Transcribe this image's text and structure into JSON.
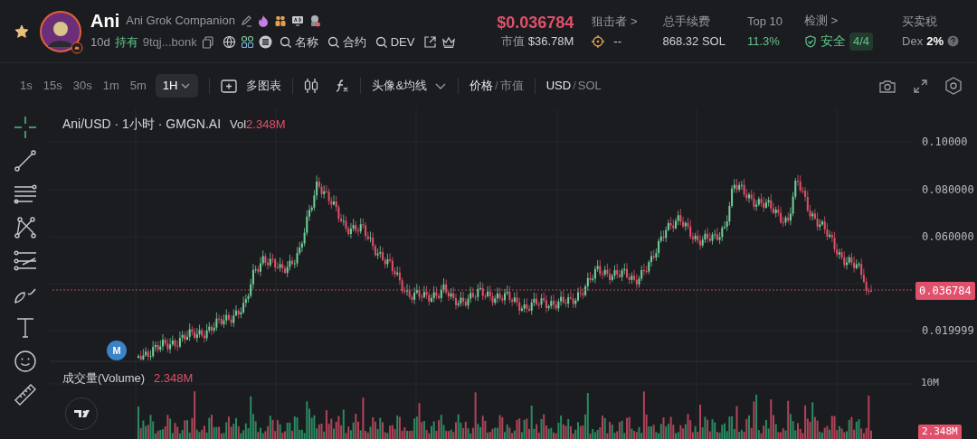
{
  "header": {
    "favorite": true,
    "name": "Ani",
    "full_name": "Ani Grok Companion",
    "age": "10d",
    "holders_label": "持有",
    "address": "9tqj...bonk",
    "searches": [
      "名称",
      "合约",
      "DEV"
    ]
  },
  "stats": {
    "price": "$0.036784",
    "market_cap_label": "市值",
    "market_cap": "$36.78M",
    "items": [
      {
        "kind": "sniper",
        "label": "狙击者 >",
        "value": "--"
      },
      {
        "kind": "plain",
        "label": "总手续费",
        "value": "868.32 SOL"
      },
      {
        "kind": "positive",
        "label": "Top 10",
        "value": "11.3%"
      },
      {
        "kind": "check",
        "label": "检测 >",
        "value": "安全",
        "badge": "4/4"
      },
      {
        "kind": "tax",
        "label": "买卖税",
        "prefix": "Dex",
        "value": "2%"
      }
    ]
  },
  "toolbar": {
    "intervals": [
      {
        "label": "1s",
        "selected": false
      },
      {
        "label": "15s",
        "selected": false
      },
      {
        "label": "30s",
        "selected": false
      },
      {
        "label": "1m",
        "selected": false
      },
      {
        "label": "5m",
        "selected": false
      },
      {
        "label": "1H",
        "selected": true
      }
    ],
    "multi_chart": "多图表",
    "indicators": "头像&均线",
    "price_toggle": [
      {
        "label": "价格",
        "selected": true
      },
      {
        "label": "市值",
        "selected": false
      }
    ],
    "price_separator": "/",
    "currency_toggle": [
      {
        "label": "USD",
        "selected": true
      },
      {
        "label": "SOL",
        "selected": false
      }
    ],
    "currency_separator": "/"
  },
  "chart": {
    "title": "Ani/USD · 1小时 · GMGN.AI",
    "vol_label": "Vol",
    "vol_value": "2.348M",
    "y_labels": [
      "0.10000",
      "0.080000",
      "0.060000",
      "0.019999"
    ],
    "price_tag": "0.036784",
    "marker": "M",
    "volume_label": "成交量(Volume)",
    "volume_value": "2.348M",
    "volume_axis": "10M",
    "volume_tag": "2.348M"
  }
}
